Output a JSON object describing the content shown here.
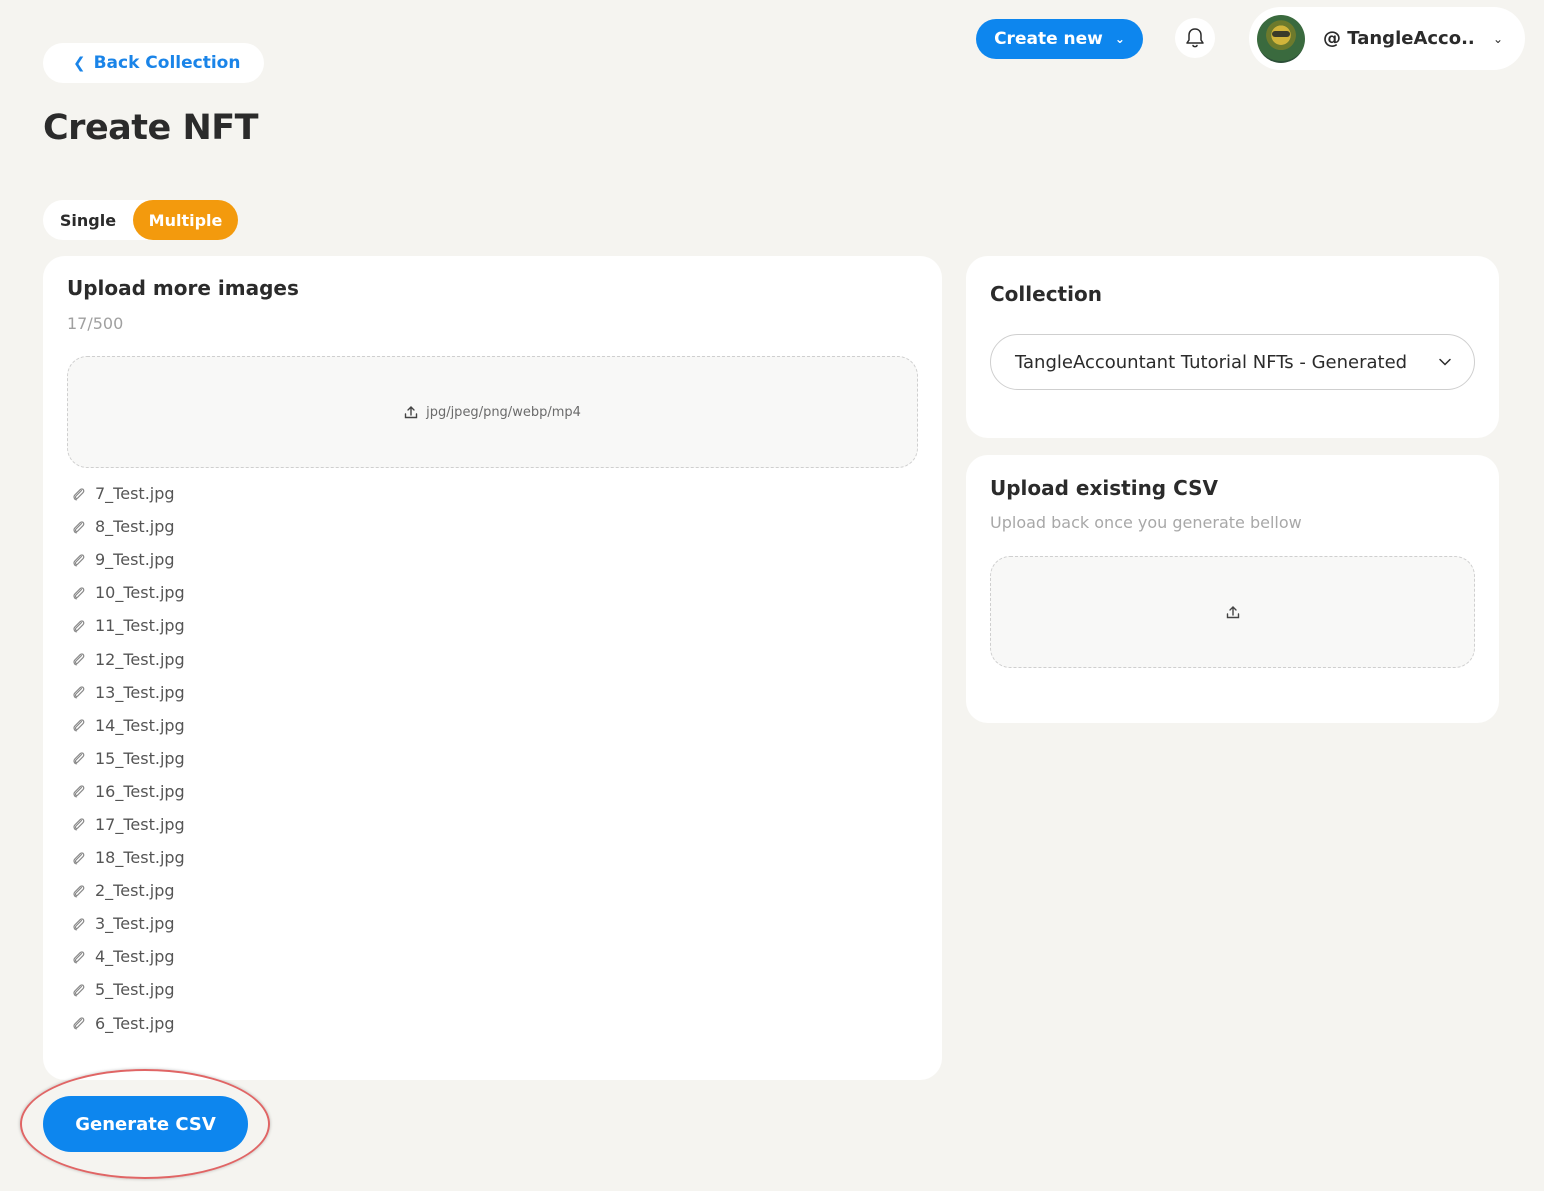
{
  "header": {
    "back_label": "Back Collection",
    "create_new_label": "Create new",
    "account_name": "@ TangleAcco...",
    "icons": {
      "back": "chevron-left-icon",
      "bell": "bell-icon",
      "dropdown": "chevron-down-icon"
    }
  },
  "page": {
    "title": "Create NFT"
  },
  "tabs": {
    "single": "Single",
    "multiple": "Multiple",
    "active": "Multiple",
    "active_color": "#f39a0d"
  },
  "upload_card": {
    "title": "Upload more images",
    "counter": "17/500",
    "dropzone_hint": "jpg/jpeg/png/webp/mp4",
    "files": [
      "7_Test.jpg",
      "8_Test.jpg",
      "9_Test.jpg",
      "10_Test.jpg",
      "11_Test.jpg",
      "12_Test.jpg",
      "13_Test.jpg",
      "14_Test.jpg",
      "15_Test.jpg",
      "16_Test.jpg",
      "17_Test.jpg",
      "18_Test.jpg",
      "2_Test.jpg",
      "3_Test.jpg",
      "4_Test.jpg",
      "5_Test.jpg",
      "6_Test.jpg"
    ]
  },
  "collection_card": {
    "title": "Collection",
    "selected": "TangleAccountant Tutorial NFTs - Generated"
  },
  "csv_card": {
    "title": "Upload existing CSV",
    "subtitle": "Upload back once you generate bellow"
  },
  "footer": {
    "generate_label": "Generate CSV"
  },
  "colors": {
    "primary": "#0d86ee",
    "accent": "#f39a0d",
    "background": "#f5f4f0",
    "highlight": "#e06565"
  }
}
